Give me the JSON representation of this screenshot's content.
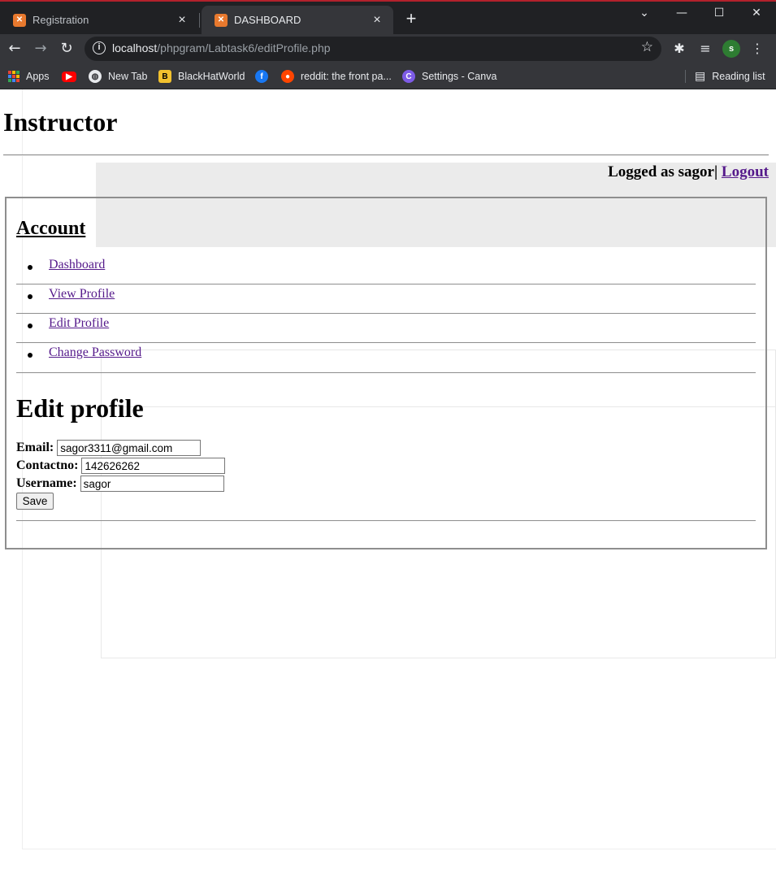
{
  "browser": {
    "tabs": [
      {
        "title": "Registration",
        "active": false,
        "favicon": "xampp-icon"
      },
      {
        "title": "DASHBOARD",
        "active": true,
        "favicon": "xampp-icon"
      }
    ],
    "new_tab_symbol": "+",
    "window_controls": {
      "minimize": "—",
      "maximize": "☐",
      "close": "✕",
      "tab_search": "⌄"
    },
    "address": {
      "host": "localhost",
      "path": "/phpgram/Labtask6/editProfile.php"
    },
    "profile_initial": "s",
    "bookmarks": [
      {
        "label": "Apps",
        "icon": "apps-grid-icon"
      },
      {
        "label": "",
        "icon": "youtube-icon"
      },
      {
        "label": "New Tab",
        "icon": "globe-icon"
      },
      {
        "label": "BlackHatWorld",
        "icon": "blackhatworld-icon"
      },
      {
        "label": "",
        "icon": "facebook-icon"
      },
      {
        "label": "reddit: the front pa...",
        "icon": "reddit-icon"
      },
      {
        "label": "Settings - Canva",
        "icon": "canva-icon"
      }
    ],
    "reading_list": "Reading list"
  },
  "page": {
    "site_title": "Instructor",
    "logged_prefix": "Logged as sagor|",
    "logout_label": "Logout",
    "account_title": "Account",
    "menu": [
      {
        "label": "Dashboard"
      },
      {
        "label": "View Profile"
      },
      {
        "label": "Edit Profile"
      },
      {
        "label": "Change Password"
      }
    ],
    "edit_title": "Edit profile",
    "form": {
      "email_label": "Email:",
      "email_value": "sagor3311@gmail.com",
      "contact_label": "Contactno:",
      "contact_value": "142626262",
      "username_label": "Username:",
      "username_value": "sagor",
      "save_label": "Save"
    }
  },
  "colors": {
    "chrome_dark": "#202124",
    "chrome_toolbar": "#35363a",
    "visited_link": "#551a8b",
    "favicon_orange": "#e8792e"
  }
}
